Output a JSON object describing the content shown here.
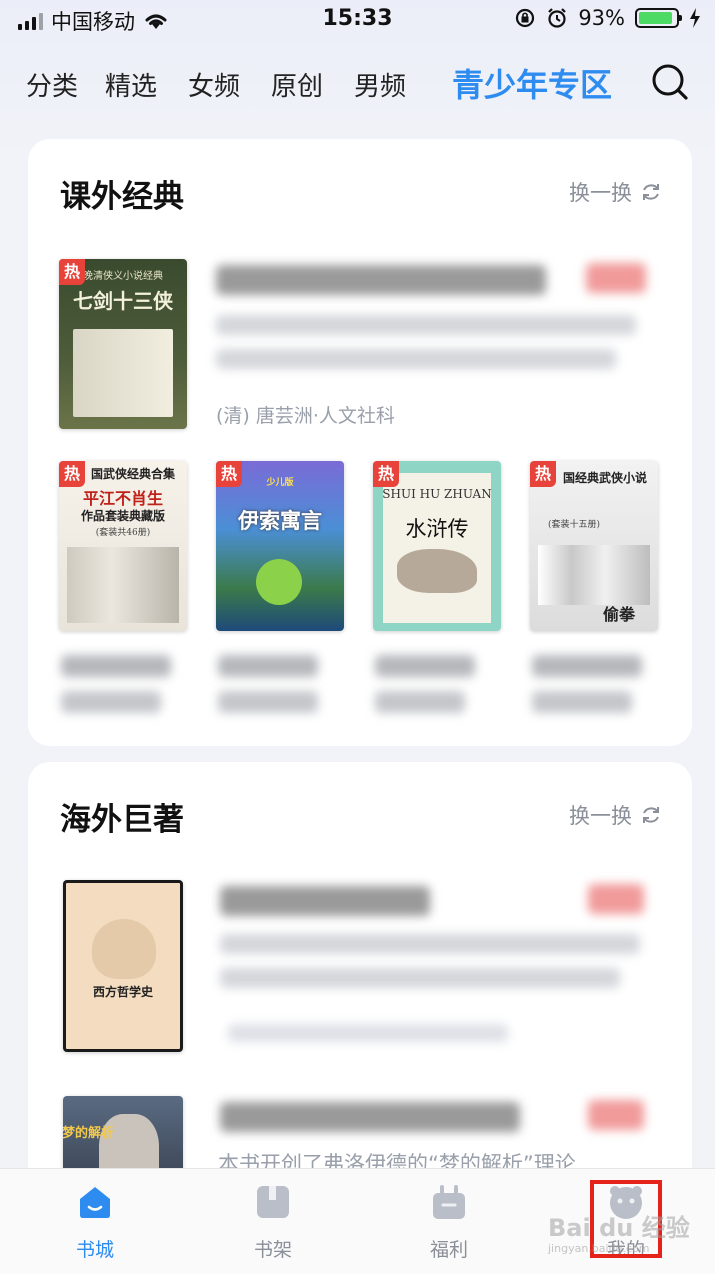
{
  "status_bar": {
    "carrier": "中国移动",
    "time": "15:33",
    "battery": "93%",
    "battery_level": 0.93
  },
  "top_nav": {
    "tabs": [
      "分类",
      "精选",
      "女频",
      "原创",
      "男频"
    ],
    "active_tab": "青少年专区"
  },
  "section1": {
    "title": "课外经典",
    "refresh_label": "换一换",
    "featured": {
      "hot_badge": "热",
      "cover_title": "七剑十三侠",
      "cover_subtitle": "晚清侠义小说经典",
      "meta": "(清) 唐芸洲·人文社科"
    },
    "books": [
      {
        "hot_badge": "热",
        "cover_line1": "国武侠经典合集",
        "cover_line2": "平江不肖生",
        "cover_line3": "作品套装典藏版",
        "cover_line4": "(套装共46册)"
      },
      {
        "hot_badge": "热",
        "cover_line1": "少儿版",
        "cover_line2": "伊索寓言"
      },
      {
        "hot_badge": "热",
        "cover_line1": "SHUI HU ZHUAN",
        "cover_line2": "水浒传"
      },
      {
        "hot_badge": "热",
        "cover_line1": "国经典武侠小说",
        "cover_line2": "(套装十五册)",
        "cover_line3": "偷拳"
      }
    ]
  },
  "section2": {
    "title": "海外巨著",
    "refresh_label": "换一换",
    "books": [
      {
        "cover_title": "西方哲学史"
      },
      {
        "cover_title": "梦的解析",
        "desc": "本书开创了弗洛伊德的“梦的解析”理论,"
      }
    ]
  },
  "bottom_nav": {
    "items": [
      "书城",
      "书架",
      "福利",
      "我的"
    ],
    "active": "书城"
  },
  "watermark": {
    "main": "Bai du 经验",
    "sub": "jingyan.baidu.com"
  },
  "colors": {
    "accent": "#2e8cf0",
    "hot": "#e8433a",
    "highlight": "#e5231b"
  }
}
